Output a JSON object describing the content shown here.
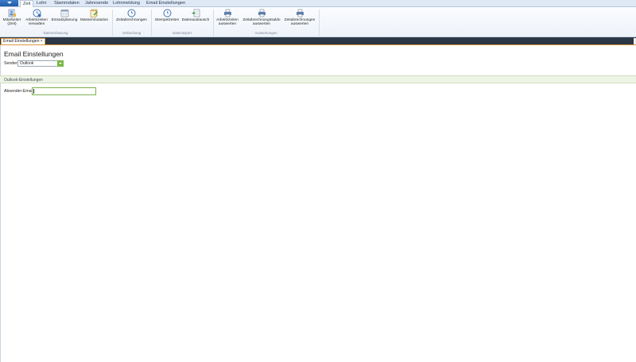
{
  "ribbon_tabs": [
    {
      "label": "Zeit",
      "active": true
    },
    {
      "label": "Lohn",
      "active": false
    },
    {
      "label": "Stammdaten",
      "active": false
    },
    {
      "label": "Jahresende",
      "active": false
    },
    {
      "label": "Lohnmeldung",
      "active": false
    },
    {
      "label": "Email Einstellungen",
      "active": false
    }
  ],
  "ribbon": {
    "buttons": [
      {
        "label1": "Mitarbeiter",
        "label2": "(Zeit)",
        "icon": "employee-icon"
      },
      {
        "label1": "Arbeitszeiten",
        "label2": "verwalten",
        "icon": "clock-icon"
      },
      {
        "label1": "Einsatzplanung",
        "label2": "",
        "icon": "calendar-icon"
      },
      {
        "label1": "Massenmutation",
        "label2": "",
        "icon": "mass-edit-icon"
      },
      {
        "label1": "Zeitabrechnungen",
        "label2": "",
        "icon": "clock-icon"
      },
      {
        "label1": "Stempelzeiten",
        "label2": "",
        "icon": "clock-icon"
      },
      {
        "label1": "Datenaustausch",
        "label2": "",
        "icon": "data-exchange-icon"
      },
      {
        "label1": "Arbeitszeiten",
        "label2": "auswerten",
        "icon": "printer-icon"
      },
      {
        "label1": "Zeitabrechnungssaldo",
        "label2": "auswerten",
        "icon": "printer-icon"
      },
      {
        "label1": "Zeitabrechnungen",
        "label2": "auswerten",
        "icon": "printer-icon"
      }
    ],
    "groups": [
      "Datenerfassung",
      "Verbuchung",
      "Datenimport",
      "Auswertungen"
    ]
  },
  "doc_tab": {
    "label": "Email Einstellungen",
    "close": "×"
  },
  "page": {
    "title": "Email Einstellungen",
    "sender_label": "Sender",
    "sender_value": "Outlook",
    "section_title": "Outlook-Einstellungen",
    "email_label": "Absender-Email",
    "email_value": ""
  },
  "colors": {
    "accent_green": "#7ab648",
    "app_menu_blue": "#1f5ea8",
    "dark_strip": "#2c3746",
    "tab_orange": "#e3a34a"
  }
}
